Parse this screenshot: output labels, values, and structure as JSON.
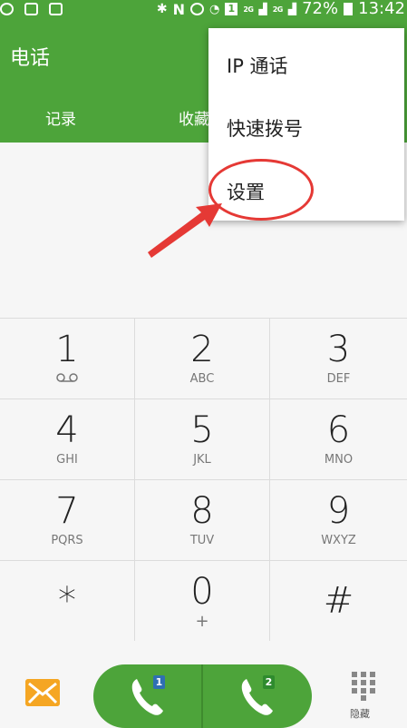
{
  "status_bar": {
    "battery": "72%",
    "time": "13:42",
    "network_1": "2G",
    "network_2": "2G",
    "sim_indicator": "1",
    "icons": [
      "minus-circle-icon",
      "image-icon",
      "notification-icon",
      "bluetooth-icon",
      "nfc-icon",
      "alarm-icon",
      "wifi-icon",
      "sim-icon",
      "signal-icon",
      "signal-icon",
      "battery-icon"
    ]
  },
  "app_bar": {
    "title": "电话",
    "tabs": [
      {
        "label": "记录"
      },
      {
        "label": "收藏"
      }
    ]
  },
  "menu": {
    "items": [
      {
        "label": "IP 通话"
      },
      {
        "label": "快速拨号"
      },
      {
        "label": "设置"
      }
    ]
  },
  "keypad": {
    "keys": [
      {
        "digit": "1",
        "letters": ""
      },
      {
        "digit": "2",
        "letters": "ABC"
      },
      {
        "digit": "3",
        "letters": "DEF"
      },
      {
        "digit": "4",
        "letters": "GHI"
      },
      {
        "digit": "5",
        "letters": "JKL"
      },
      {
        "digit": "6",
        "letters": "MNO"
      },
      {
        "digit": "7",
        "letters": "PQRS"
      },
      {
        "digit": "8",
        "letters": "TUV"
      },
      {
        "digit": "9",
        "letters": "WXYZ"
      },
      {
        "digit": "*",
        "letters": ""
      },
      {
        "digit": "0",
        "letters": "+"
      },
      {
        "digit": "#",
        "letters": ""
      }
    ]
  },
  "bottom": {
    "sim1_label": "1",
    "sim2_label": "2",
    "hide_label": "隐藏"
  },
  "colors": {
    "accent": "#4da43a",
    "highlight": "#e53935",
    "message": "#f5a623"
  }
}
